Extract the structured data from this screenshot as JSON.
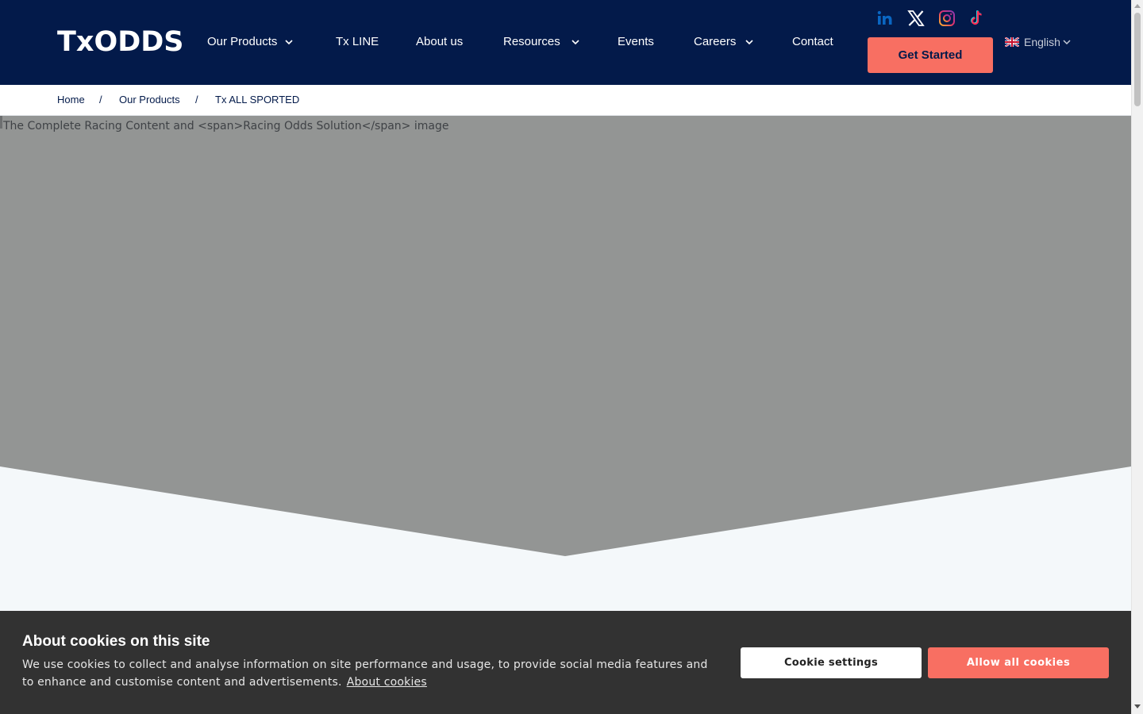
{
  "header": {
    "logo": "TxODDS",
    "nav": [
      {
        "label": "Our Products",
        "has_dropdown": true
      },
      {
        "label": "Tx LINE",
        "has_dropdown": false
      },
      {
        "label": "About us",
        "has_dropdown": false
      },
      {
        "label": "Resources",
        "has_dropdown": true
      },
      {
        "label": "Events",
        "has_dropdown": false
      },
      {
        "label": "Careers",
        "has_dropdown": true
      },
      {
        "label": "Contact",
        "has_dropdown": false
      }
    ],
    "social": [
      {
        "icon": "linkedin-icon",
        "color": "#0a66c2"
      },
      {
        "icon": "x-twitter-icon",
        "color": "#ffffff"
      },
      {
        "icon": "instagram-icon",
        "color": "#d6249f"
      },
      {
        "icon": "tiktok-icon",
        "color": "#fe2c55"
      }
    ],
    "cta_label": "Get Started",
    "language": {
      "label": "English",
      "flag": "uk-flag-icon"
    }
  },
  "breadcrumb": {
    "items": [
      "Home",
      "Our Products",
      "Tx ALL SPORTED"
    ],
    "separator": "/"
  },
  "hero": {
    "image_alt": "The Complete Racing Content and <span>Racing Odds Solution</span> image"
  },
  "cookie_banner": {
    "title": "About cookies on this site",
    "text": "We use cookies to collect and analyse information on site performance and usage, to provide social media features and to enhance and customise content and advertisements.",
    "link_label": "About cookies",
    "settings_label": "Cookie settings",
    "allow_label": "Allow all cookies"
  },
  "colors": {
    "header_bg": "#031a4a",
    "accent": "#f86f62",
    "hero_bg": "#939594",
    "page_bg": "#f4f8fa",
    "cookie_bg": "#323232"
  }
}
